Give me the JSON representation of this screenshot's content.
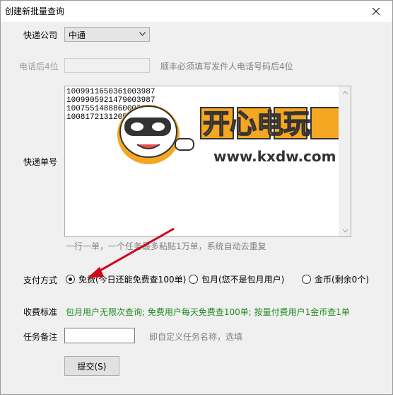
{
  "window": {
    "title": "创建新批量查询"
  },
  "form": {
    "company_label": "快递公司",
    "company_value": "中通",
    "phone_label": "电话后4位",
    "phone_value": "",
    "phone_hint": "顺丰必须填写发件人电话号码后4位",
    "numbers_label": "快递单号",
    "numbers": [
      "1009911650361003987",
      "1009905921479003987",
      "1007551488860003987",
      "1008172131205003987"
    ],
    "numbers_hint": "一行一单，一个任务最多粘贴1万单，系统自动去重复",
    "payment_label": "支付方式",
    "payment_options": [
      {
        "label": "免费(今日还能免费查100单)",
        "checked": true
      },
      {
        "label": "包月(您不是包月用户)",
        "checked": false
      },
      {
        "label": "金币(剩余0个)",
        "checked": false
      }
    ],
    "fee_label": "收费标准",
    "fee_text": "包月用户无限次查询; 免费用户每天免费查100单; 按量付费用户1金币查1单",
    "note_label": "任务备注",
    "note_value": "",
    "note_hint": "即自定义任务名称，选填",
    "submit_label": "提交(S)"
  },
  "watermark": {
    "brand": "开心电玩",
    "site": "www.kxdw.com"
  },
  "colors": {
    "fee_text": "#1f8a1f",
    "annotation_arrow": "#d0021b",
    "watermark_orange": "#f5a623"
  }
}
